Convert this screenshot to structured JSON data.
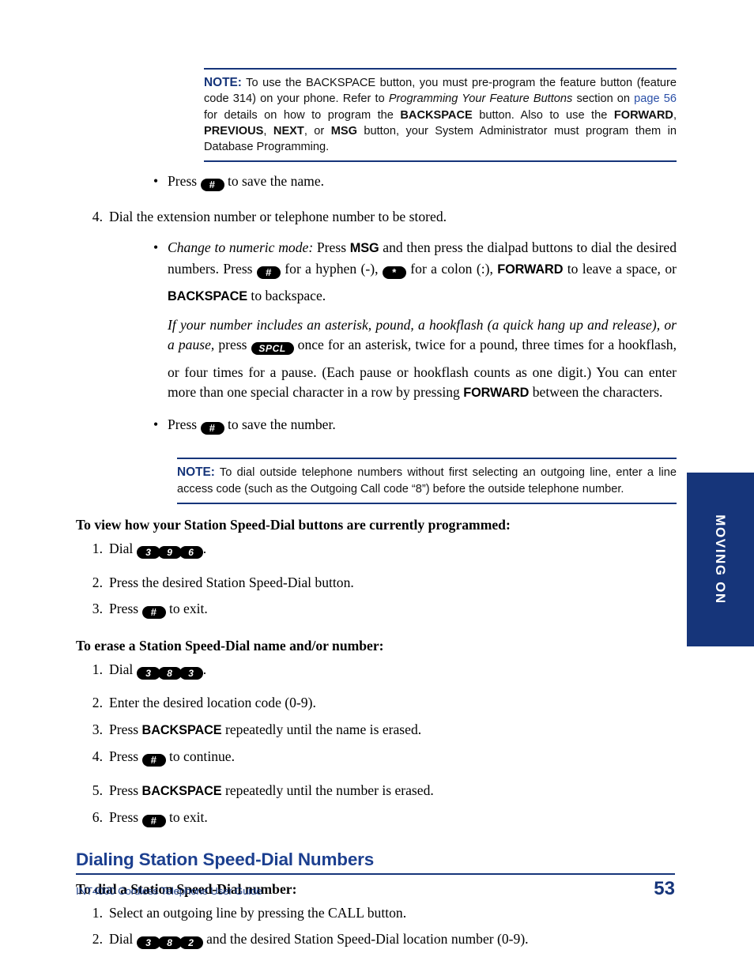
{
  "document": {
    "footer_text": "INT4000 Cordless Telephone User Guide",
    "page_number": "53",
    "side_tab_label": "MOVING ON"
  },
  "note1": {
    "label": "NOTE:",
    "part1": " To use the BACKSPACE button, you must pre-program the feature button (feature code 314) on your phone. Refer to ",
    "italic1": "Programming Your Feature Buttons",
    "part2": " section on ",
    "link": "page 56",
    "part3": " for details on how to program the ",
    "bold1": "BACKSPACE",
    "part4": " button. Also to use the ",
    "bold2": "FORWARD",
    "part5": ", ",
    "bold3": "PREVIOUS",
    "part6": ", ",
    "bold4": "NEXT",
    "part7": ", or ",
    "bold5": "MSG",
    "part8": " button, your System Administrator must program them in Database Programming."
  },
  "bullet_save_name": {
    "pre": "Press ",
    "key": "#",
    "post": " to save the name."
  },
  "step4": {
    "number": "4.",
    "text": "Dial the extension number or telephone number to be stored."
  },
  "numeric_mode": {
    "italic_lead": "Change to numeric mode:",
    "p1": " Press ",
    "msg": "MSG",
    "p2": " and then press the dialpad buttons to dial the desired numbers. Press ",
    "hash": "#",
    "p3": " for a hyphen (-), ",
    "star": "*",
    "p4": " for a colon (:), ",
    "forward": "FORWARD",
    "p5": " to leave a space, or ",
    "backspace": "BACKSPACE",
    "p6": " to backspace."
  },
  "special_chars": {
    "italic_lead": "If your number includes an asterisk, pound, a hookflash (a quick hang up and release), or a pause,",
    "p1": " press ",
    "spcl": "SPCL",
    "p2": " once for an asterisk, twice for a pound, three times for a hookflash, or four times for a pause. (Each pause or hookflash counts as one digit.) You can enter more than one special character in a row by pressing ",
    "forward": "FORWARD",
    "p3": " between the characters."
  },
  "bullet_save_number": {
    "pre": "Press ",
    "key": "#",
    "post": " to save the number."
  },
  "note2": {
    "label": "NOTE:",
    "text": " To dial outside telephone numbers without first selecting an outgoing line, enter a line access code (such as the Outgoing Call code “8”) before the outside telephone number."
  },
  "view_section": {
    "heading": "To view how your Station Speed-Dial buttons are currently programmed:",
    "steps": [
      {
        "number": "1.",
        "pre": "Dial ",
        "keys": [
          "3",
          "9",
          "6"
        ],
        "post": "."
      },
      {
        "number": "2.",
        "pre": "Press the desired Station Speed-Dial button.",
        "keys": [],
        "post": ""
      },
      {
        "number": "3.",
        "pre": "Press ",
        "keys": [
          "#"
        ],
        "post": " to exit."
      }
    ]
  },
  "erase_section": {
    "heading": "To erase a Station Speed-Dial name and/or number:",
    "steps": [
      {
        "number": "1.",
        "pre": "Dial ",
        "keys": [
          "3",
          "8",
          "3"
        ],
        "post": "."
      },
      {
        "number": "2.",
        "pre": "Enter the desired location code (0-9).",
        "keys": [],
        "post": ""
      },
      {
        "number": "3.",
        "pre": "Press ",
        "keyword": "BACKSPACE",
        "post": " repeatedly until the name is erased."
      },
      {
        "number": "4.",
        "pre": "Press ",
        "keys": [
          "#"
        ],
        "post": " to continue."
      },
      {
        "number": "5.",
        "pre": "Press ",
        "keyword": "BACKSPACE",
        "post": " repeatedly until the number is erased."
      },
      {
        "number": "6.",
        "pre": "Press ",
        "keys": [
          "#"
        ],
        "post": " to exit."
      }
    ]
  },
  "dialing_section": {
    "heading": "Dialing Station Speed-Dial Numbers",
    "sub_heading": "To dial a Station Speed-Dial number:",
    "steps": [
      {
        "number": "1.",
        "pre": "Select an outgoing line by pressing the CALL button.",
        "keys": [],
        "post": ""
      },
      {
        "number": "2.",
        "pre": "Dial ",
        "keys": [
          "3",
          "8",
          "2"
        ],
        "post": " and the desired Station Speed-Dial location number (0-9)."
      }
    ]
  },
  "colors": {
    "navy": "#16357A",
    "heading_blue": "#1C3F8F",
    "link_blue": "#2B50A8"
  }
}
